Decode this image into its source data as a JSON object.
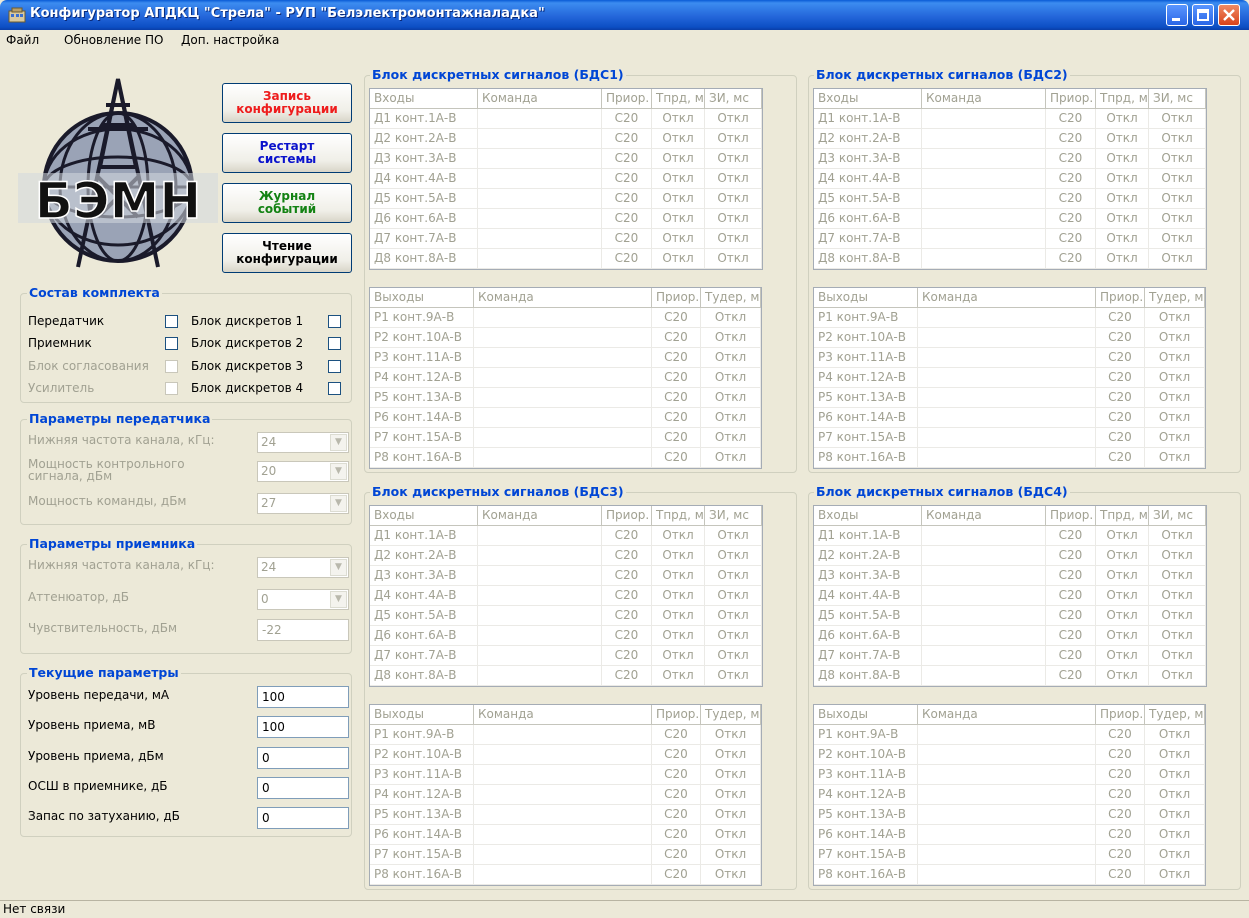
{
  "window": {
    "title": "Конфигуратор АПДКЦ \"Стрела\" - РУП \"Белэлектромонтажналадка\""
  },
  "menu": [
    "Файл",
    "Обновление ПО",
    "Доп. настройка"
  ],
  "logo_text": "БЭМН",
  "buttons": {
    "write_config": [
      "Запись",
      "конфигурации"
    ],
    "restart": [
      "Рестарт",
      "системы"
    ],
    "event_log": [
      "Журнал",
      "событий"
    ],
    "read_config": [
      "Чтение",
      "конфигурации"
    ]
  },
  "colors": {
    "write": "#ee1c1c",
    "restart": "#0a12cc",
    "log": "#138213",
    "read": "#000000"
  },
  "kit": {
    "title": "Состав комплекта",
    "left": [
      {
        "label": "Передатчик",
        "enabled": true
      },
      {
        "label": "Приемник",
        "enabled": true
      },
      {
        "label": "Блок согласования",
        "enabled": false
      },
      {
        "label": "Усилитель",
        "enabled": false
      }
    ],
    "right": [
      {
        "label": "Блок дискретов 1"
      },
      {
        "label": "Блок дискретов 2"
      },
      {
        "label": "Блок дискретов 3"
      },
      {
        "label": "Блок дискретов 4"
      }
    ]
  },
  "tx": {
    "title": "Параметры передатчика",
    "freq_label": "Нижняя частота канала, кГц:",
    "freq_value": "24",
    "ctrl_label_1": "Мощность контрольного",
    "ctrl_label_2": "сигнала, дБм",
    "ctrl_value": "20",
    "cmd_label": "Мощность команды, дБм",
    "cmd_value": "27"
  },
  "rx": {
    "title": "Параметры приемника",
    "freq_label": "Нижняя частота канала, кГц:",
    "freq_value": "24",
    "att_label": "Аттенюатор, дБ",
    "att_value": "0",
    "sens_label": "Чувствительность, дБм",
    "sens_value": "-22"
  },
  "current": {
    "title": "Текущие параметры",
    "rows": [
      {
        "label": "Уровень передачи, мА",
        "value": "100"
      },
      {
        "label": "Уровень приема, мВ",
        "value": "100"
      },
      {
        "label": "Уровень приема, дБм",
        "value": "0"
      },
      {
        "label": "ОСШ в приемнике, дБ",
        "value": "0"
      },
      {
        "label": "Запас по затуханию, дБ",
        "value": "0"
      }
    ]
  },
  "blocks": [
    {
      "title": "Блок дискретных сигналов (БДС1)"
    },
    {
      "title": "Блок дискретных сигналов (БДС2)"
    },
    {
      "title": "Блок дискретных сигналов (БДС3)"
    },
    {
      "title": "Блок дискретных сигналов (БДС4)"
    }
  ],
  "inputs_header": [
    "Входы",
    "Команда",
    "Приор.",
    "Тпрд, мс",
    "ЗИ, мс"
  ],
  "inputs_rows": [
    [
      "Д1 конт.1А-В",
      "",
      "С20",
      "Откл",
      "Откл"
    ],
    [
      "Д2 конт.2А-В",
      "",
      "С20",
      "Откл",
      "Откл"
    ],
    [
      "Д3 конт.3А-В",
      "",
      "С20",
      "Откл",
      "Откл"
    ],
    [
      "Д4 конт.4А-В",
      "",
      "С20",
      "Откл",
      "Откл"
    ],
    [
      "Д5 конт.5А-В",
      "",
      "С20",
      "Откл",
      "Откл"
    ],
    [
      "Д6 конт.6А-В",
      "",
      "С20",
      "Откл",
      "Откл"
    ],
    [
      "Д7 конт.7А-В",
      "",
      "С20",
      "Откл",
      "Откл"
    ],
    [
      "Д8 конт.8А-В",
      "",
      "С20",
      "Откл",
      "Откл"
    ]
  ],
  "outputs_header": [
    "Выходы",
    "Команда",
    "Приор.",
    "Тудер, мс"
  ],
  "outputs_rows": [
    [
      "Р1 конт.9А-В",
      "",
      "С20",
      "Откл"
    ],
    [
      "Р2 конт.10А-В",
      "",
      "С20",
      "Откл"
    ],
    [
      "Р3 конт.11А-В",
      "",
      "С20",
      "Откл"
    ],
    [
      "Р4 конт.12А-В",
      "",
      "С20",
      "Откл"
    ],
    [
      "Р5 конт.13А-В",
      "",
      "С20",
      "Откл"
    ],
    [
      "Р6 конт.14А-В",
      "",
      "С20",
      "Откл"
    ],
    [
      "Р7 конт.15А-В",
      "",
      "С20",
      "Откл"
    ],
    [
      "Р8 конт.16А-В",
      "",
      "С20",
      "Откл"
    ]
  ],
  "status": "Нет связи"
}
